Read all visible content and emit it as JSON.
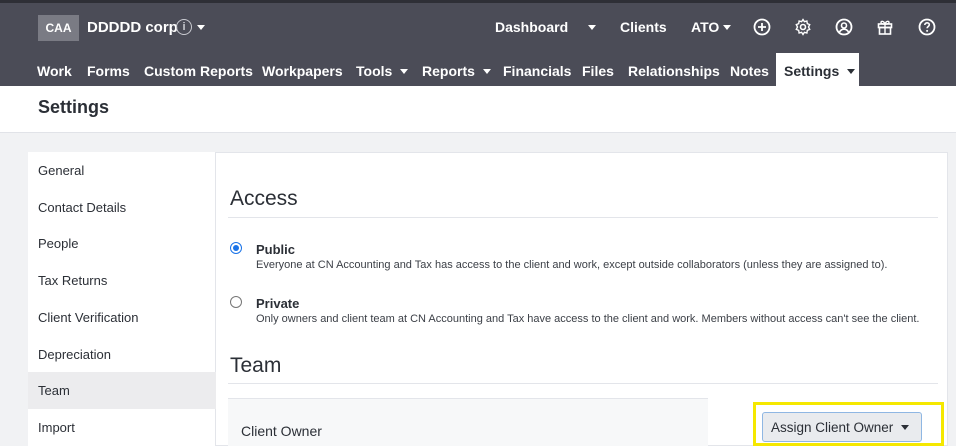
{
  "header": {
    "client_code": "CAA",
    "client_name": "DDDDD corp",
    "dashboard": "Dashboard",
    "clients": "Clients",
    "ato": "ATO"
  },
  "nav": {
    "work": "Work",
    "forms": "Forms",
    "custom_reports": "Custom Reports",
    "workpapers": "Workpapers",
    "tools": "Tools",
    "reports": "Reports",
    "financials": "Financials",
    "files": "Files",
    "relationships": "Relationships",
    "notes": "Notes",
    "settings": "Settings"
  },
  "page": {
    "title": "Settings"
  },
  "sidebar": {
    "items": [
      {
        "label": "General"
      },
      {
        "label": "Contact Details"
      },
      {
        "label": "People"
      },
      {
        "label": "Tax Returns"
      },
      {
        "label": "Client Verification"
      },
      {
        "label": "Depreciation"
      },
      {
        "label": "Team"
      },
      {
        "label": "Import"
      }
    ]
  },
  "access": {
    "title": "Access",
    "public_label": "Public",
    "public_desc": "Everyone at CN Accounting and Tax has access to the client and work, except outside collaborators (unless they are assigned to).",
    "private_label": "Private",
    "private_desc": "Only owners and client team at CN Accounting and Tax have access to the client and work. Members without access can't see the client."
  },
  "team": {
    "title": "Team",
    "client_owner_label": "Client Owner",
    "assign_button": "Assign Client Owner"
  },
  "icons": [
    "info-icon",
    "plus-circle-icon",
    "gear-icon",
    "user-circle-icon",
    "gift-icon",
    "help-icon"
  ],
  "colors": {
    "accent": "#1a73e8",
    "topbar": "#4b4c57",
    "highlight": "#f5e800"
  }
}
